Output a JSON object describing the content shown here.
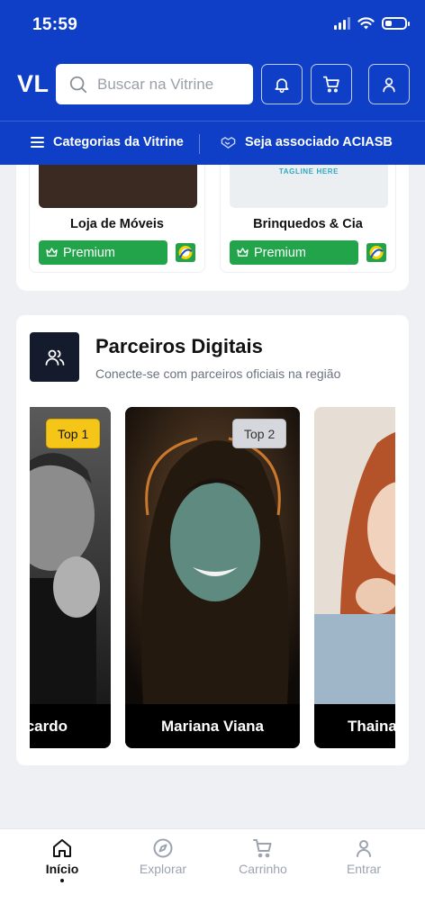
{
  "status_bar": {
    "time": "15:59"
  },
  "header": {
    "logo": "VL",
    "search_placeholder": "Buscar na Vitrine",
    "nav_categories": "Categorias da Vitrine",
    "nav_associate": "Seja associado ACIASB"
  },
  "stores": [
    {
      "name": "Loja de Móveis",
      "badge": "Premium",
      "image_color": "#3a2a22"
    },
    {
      "name": "Brinquedos & Cia",
      "badge": "Premium",
      "tagline": "TAGLINE HERE",
      "image_color": "#eceff1"
    }
  ],
  "partners": {
    "title": "Parceiros Digitais",
    "subtitle": "Conecte-se com parceiros oficiais na região",
    "items": [
      {
        "name": "cardo",
        "rank": "Top 1",
        "rank_color": "#f5c518"
      },
      {
        "name": "Mariana Viana",
        "rank": "Top 2",
        "rank_color": "#d5d7dc"
      },
      {
        "name": "Thaina",
        "rank": "",
        "rank_color": ""
      }
    ]
  },
  "bottom_nav": [
    {
      "label": "Início",
      "icon": "home-icon",
      "active": true
    },
    {
      "label": "Explorar",
      "icon": "compass-icon",
      "active": false
    },
    {
      "label": "Carrinho",
      "icon": "cart-icon",
      "active": false
    },
    {
      "label": "Entrar",
      "icon": "user-icon",
      "active": false
    }
  ],
  "colors": {
    "brand": "#0f3fc7",
    "premium": "#21a44a",
    "dark_icon_bg": "#141b2d"
  }
}
